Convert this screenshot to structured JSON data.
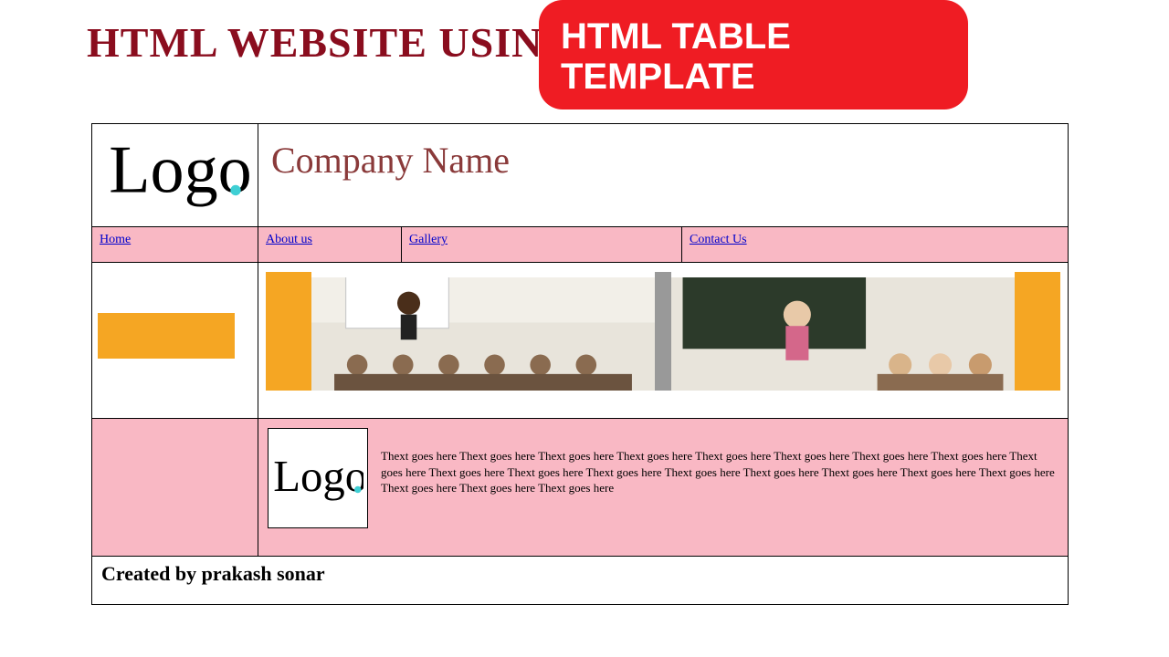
{
  "heading": "HTML WEBSITE  USING",
  "badge": {
    "line1": "HTML TABLE",
    "line2": " TEMPLATE"
  },
  "header": {
    "logo_label": "Logo.",
    "company_name": "Company Name"
  },
  "nav": {
    "home": "Home",
    "about": "About us",
    "gallery": "Gallery",
    "contact": "Contact Us"
  },
  "content": {
    "logo_label": "Logo.",
    "body": "Thext goes here Thext goes here Thext goes here Thext goes here Thext goes here Thext goes here Thext goes here Thext goes here Thext goes here Thext goes here Thext goes here Thext goes here Thext goes here Thext goes here Thext goes here Thext goes here Thext goes here Thext goes here Thext goes here Thext goes here"
  },
  "footer": "Created by prakash sonar"
}
